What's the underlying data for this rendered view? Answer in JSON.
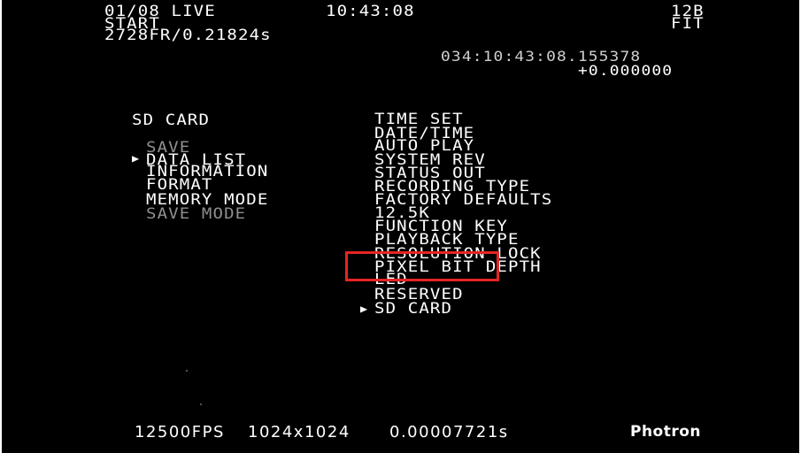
{
  "header": {
    "left_line1": "01/08 LIVE",
    "left_line2": "START",
    "left_line3": "2728FR/0.21824s",
    "center_time": "10:43:08",
    "right_line1": "12B",
    "right_line2": "FIT",
    "timestamp": "034:10:43:08.155378",
    "offset": "+0.000000"
  },
  "left_menu": {
    "title": "SD CARD",
    "items": [
      {
        "label": "SAVE",
        "enabled": false,
        "selected": false
      },
      {
        "label": "DATA LIST",
        "enabled": true,
        "selected": true
      },
      {
        "label": "INFORMATION",
        "enabled": true,
        "selected": false
      },
      {
        "label": "FORMAT",
        "enabled": true,
        "selected": false
      },
      {
        "label": "MEMORY MODE",
        "enabled": true,
        "selected": false
      },
      {
        "label": "SAVE MODE",
        "enabled": false,
        "selected": false
      }
    ]
  },
  "right_menu": {
    "items": [
      {
        "label": "TIME SET"
      },
      {
        "label": "DATE/TIME"
      },
      {
        "label": "AUTO PLAY"
      },
      {
        "label": "SYSTEM REV"
      },
      {
        "label": "STATUS OUT"
      },
      {
        "label": "RECORDING TYPE"
      },
      {
        "label": "FACTORY DEFAULTS"
      },
      {
        "label": "12.5K"
      },
      {
        "label": "FUNCTION KEY"
      },
      {
        "label": "PLAYBACK TYPE"
      },
      {
        "label": "RESOLUTION LOCK"
      },
      {
        "label": "PIXEL BIT DEPTH"
      },
      {
        "label": "LED"
      },
      {
        "label": "RESERVED"
      },
      {
        "label": "SD CARD",
        "selected": true
      }
    ],
    "highlight_color": "#e52525"
  },
  "footer": {
    "fps": "12500FPS",
    "resolution": "1024x1024",
    "shutter": "0.00007721s",
    "brand": "Photron"
  },
  "colors": {
    "background": "#000000",
    "text": "#ffffff",
    "disabled": "#8f8f8f"
  }
}
